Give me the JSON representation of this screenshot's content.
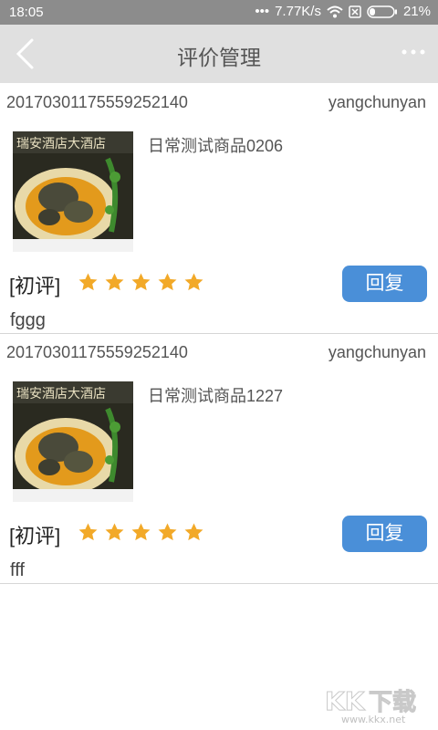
{
  "status": {
    "time": "18:05",
    "network": "7.77K/s",
    "battery": "21%"
  },
  "header": {
    "title": "评价管理"
  },
  "orders": [
    {
      "id": "20170301175559252140",
      "user": "yangchunyan",
      "product": "日常测试商品0206",
      "tag": "[初评]",
      "rating": 5,
      "reply_label": "回复",
      "comment": "fggg"
    },
    {
      "id": "20170301175559252140",
      "user": "yangchunyan",
      "product": "日常测试商品1227",
      "tag": "[初评]",
      "rating": 5,
      "reply_label": "回复",
      "comment": "fff"
    }
  ],
  "watermark": {
    "text": "KK下载",
    "url": "www.kkx.net"
  },
  "colors": {
    "accent": "#4a8fd8",
    "star": "#f2a928",
    "navbar": "#e0e0e0",
    "statusbar": "#8c8c8c"
  }
}
